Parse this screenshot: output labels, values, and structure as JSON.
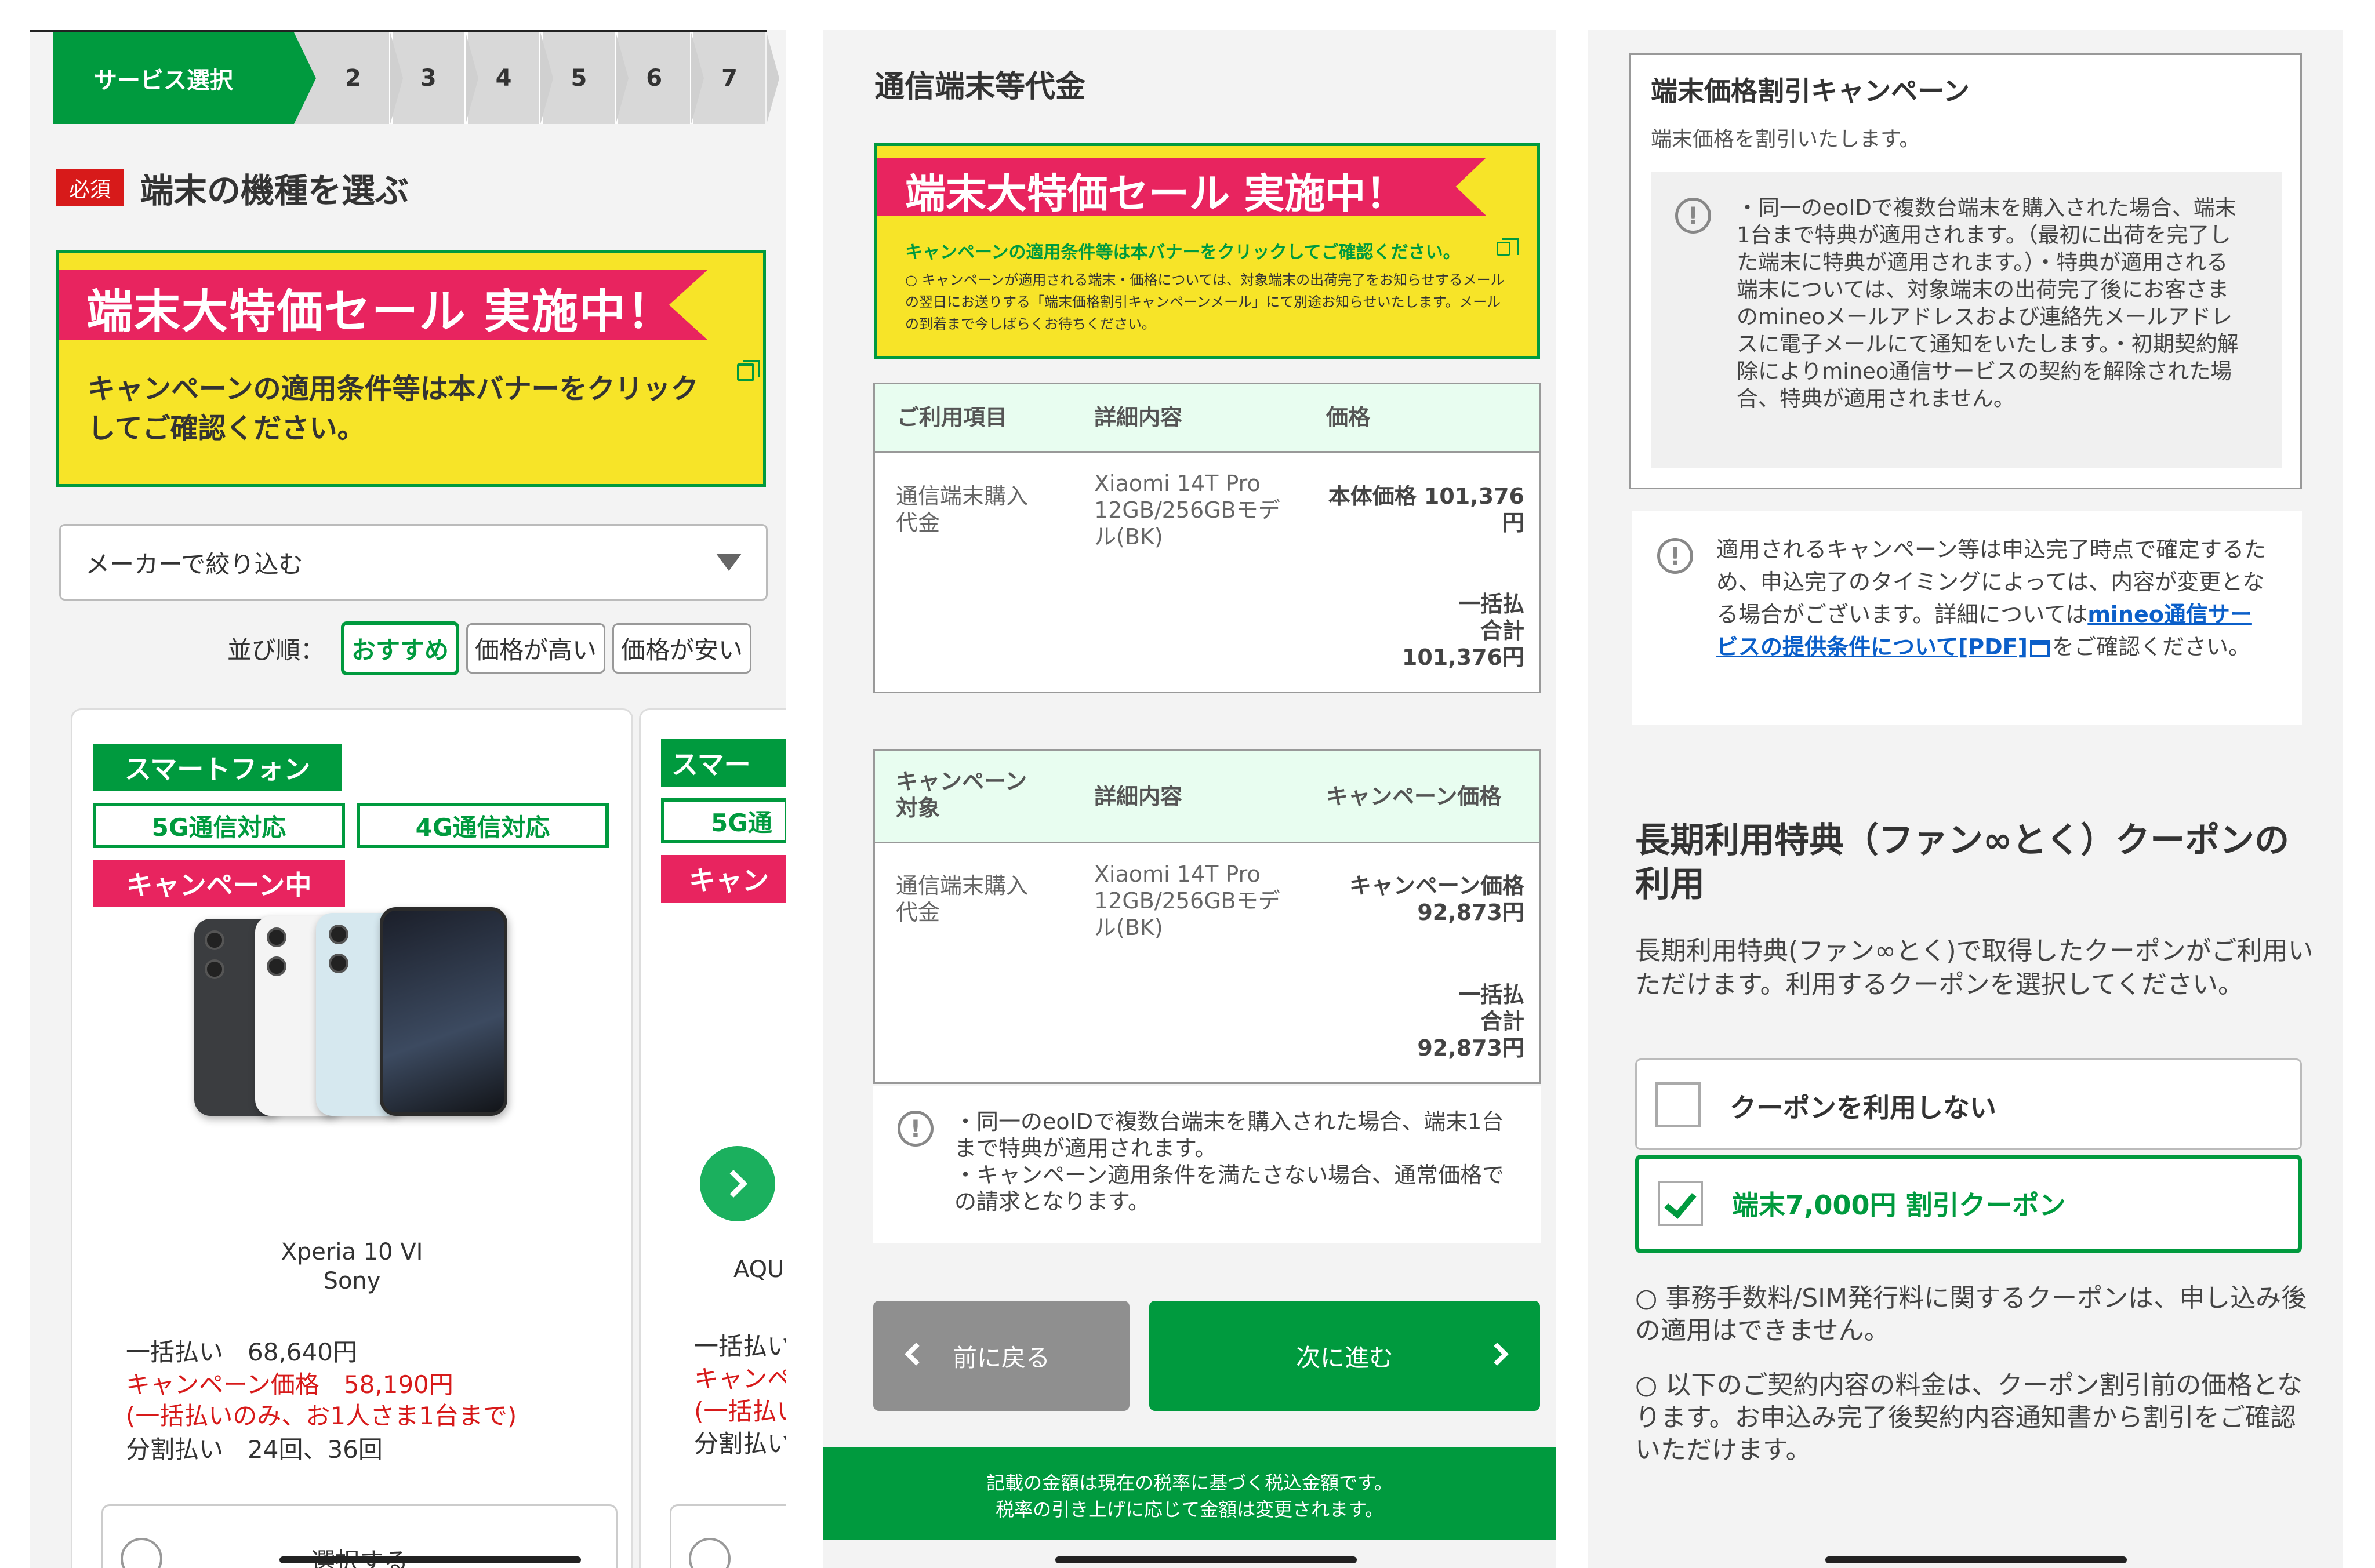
{
  "screen1": {
    "steps": {
      "active": "サービス選択",
      "items": [
        "2",
        "3",
        "4",
        "5",
        "6",
        "7"
      ]
    },
    "required_badge": "必須",
    "section_title": "端末の機種を選ぶ",
    "banner": {
      "headline": "端末大特価セール 実施中！",
      "description": "キャンペーンの適用条件等は本バナーをクリックしてご確認ください。"
    },
    "maker_filter": {
      "value": "メーカーで絞り込む"
    },
    "sort": {
      "label": "並び順：",
      "options": [
        "おすすめ",
        "価格が高い",
        "価格が安い"
      ],
      "selected": "おすすめ"
    },
    "product": {
      "type_tag": "スマートフォン",
      "network_tags": [
        "5G通信対応",
        "4G通信対応"
      ],
      "campaign_tag": "キャンペーン中",
      "name": "Xperia 10 VI",
      "maker": "Sony",
      "lump_sum": "一括払い　68,640円",
      "campaign_price": "キャンペーン価格　58,190円",
      "campaign_note": "(一括払いのみ、お1人さま1台まで)",
      "installments": "分割払い　24回、36回",
      "select_label": "選択する"
    },
    "product2": {
      "type_tag": "スマー",
      "network_tag": "5G通",
      "campaign_tag": "キャン",
      "name": "AQU",
      "lump_sum": "一括払い",
      "campaign_price": "キャンペ",
      "campaign_note": "(一括払い",
      "installments": "分割払い"
    }
  },
  "screen2": {
    "title": "通信端末等代金",
    "banner": {
      "headline": "端末大特価セール 実施中！",
      "note": "キャンペーンの適用条件等は本バナーをクリックしてご確認ください。",
      "detail": "○ キャンペーンが適用される端末・価格については、対象端末の出荷完了をお知らせするメールの翌日にお送りする「端末価格割引キャンペーンメール」にて別途お知らせいたします。メールの到着まで今しばらくお待ちください。"
    },
    "table1": {
      "headers": [
        "ご利用項目",
        "詳細内容",
        "価格"
      ],
      "item": "通信端末購入代金",
      "detail": "Xiaomi 14T Pro 12GB/256GBモデル(BK)",
      "price_label": "本体価格 101,376円",
      "total_label": "一括払合計",
      "total": "101,376円"
    },
    "table2": {
      "headers": [
        "キャンペーン対象",
        "詳細内容",
        "キャンペーン価格"
      ],
      "item": "通信端末購入代金",
      "detail": "Xiaomi 14T Pro 12GB/256GBモデル(BK)",
      "price_label": "キャンペーン価格",
      "price": "92,873円",
      "total_label": "一括払合計",
      "total": "92,873円"
    },
    "note": "・同一のeoIDで複数台端末を購入された場合、端末1台まで特典が適用されます。\n・キャンペーン適用条件を満たさない場合、通常価格での請求となります。",
    "back_button": "前に戻る",
    "next_button": "次に進む",
    "footer": "記載の金額は現在の税率に基づく税込金額です。\n税率の引き上げに応じて金額は変更されます。"
  },
  "screen3": {
    "campaign": {
      "title": "端末価格割引キャンペーン",
      "subtitle": "端末価格を割引いたします。",
      "note": "・同一のeoIDで複数台端末を購入された場合、端末1台まで特典が適用されます。（最初に出荷を完了した端末に特典が適用されます。）・特典が適用される端末については、対象端末の出荷完了後にお客さまのmineoメールアドレスおよび連絡先メールアドレスに電子メールにて通知をいたします。・初期契約解除によりmineo通信サービスの契約を解除された場合、特典が適用されません。"
    },
    "confirm_note": {
      "before": "適用されるキャンペーン等は申込完了時点で確定するため、申込完了のタイミングによっては、内容が変更となる場合がございます。詳細については",
      "link": "mineo通信サービスの提供条件について[PDF]",
      "after": "をご確認ください。"
    },
    "coupon_heading": "長期利用特典（ファン∞とく）クーポンの利用",
    "coupon_desc": "長期利用特典(ファン∞とく)で取得したクーポンがご利用いただけます。利用するクーポンを選択してください。",
    "options": [
      {
        "label": "クーポンを利用しない",
        "checked": false
      },
      {
        "label": "端末7,000円 割引クーポン",
        "checked": true
      }
    ],
    "notes": [
      "○ 事務手数料/SIM発行料に関するクーポンは、申し込み後の適用はできません。",
      "○ 以下のご契約内容の料金は、クーポン割引前の価格となります。お申込み完了後契約内容通知書から割引をご確認いただけます。"
    ]
  },
  "colors": {
    "brand_green": "#009a3e",
    "campaign_pink": "#e8245f",
    "banner_yellow": "#f7e428",
    "alert_red": "#d71a1a",
    "link_blue": "#0b5fc9"
  }
}
